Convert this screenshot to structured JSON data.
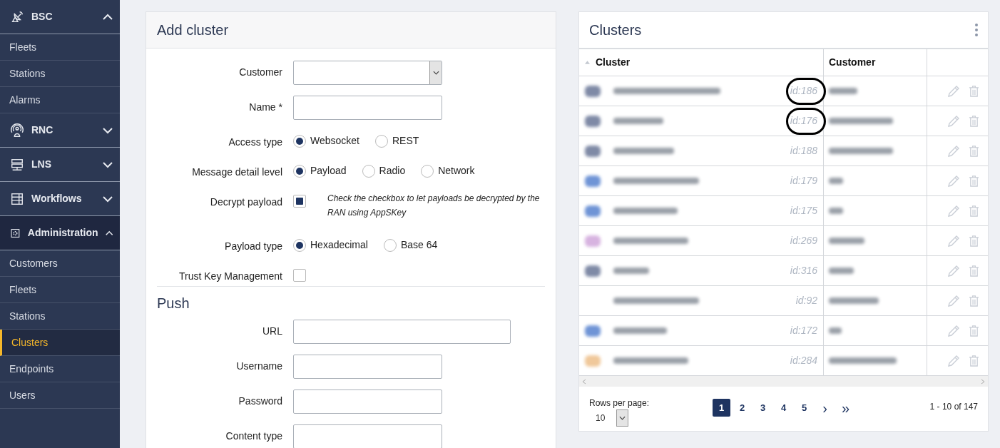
{
  "sidebar": {
    "sections": [
      {
        "label": "BSC",
        "expanded": true,
        "selected": false,
        "children": [
          {
            "label": "Fleets",
            "selected": false
          },
          {
            "label": "Stations",
            "selected": false
          },
          {
            "label": "Alarms",
            "selected": false
          }
        ]
      },
      {
        "label": "RNC",
        "expanded": false,
        "selected": false
      },
      {
        "label": "LNS",
        "expanded": false,
        "selected": false
      },
      {
        "label": "Workflows",
        "expanded": false,
        "selected": false
      },
      {
        "label": "Administration",
        "expanded": true,
        "selected": true,
        "children": [
          {
            "label": "Customers",
            "selected": false
          },
          {
            "label": "Fleets",
            "selected": false
          },
          {
            "label": "Stations",
            "selected": false
          },
          {
            "label": "Clusters",
            "selected": true
          },
          {
            "label": "Endpoints",
            "selected": false
          },
          {
            "label": "Users",
            "selected": false
          }
        ]
      }
    ]
  },
  "add_cluster": {
    "title": "Add cluster",
    "fields": [
      {
        "kind": "select",
        "label": "Customer"
      },
      {
        "kind": "text",
        "label": "Name *"
      },
      {
        "kind": "radio",
        "label": "Access type",
        "options": [
          {
            "label": "Websocket",
            "selected": true
          },
          {
            "label": "REST",
            "selected": false
          }
        ]
      },
      {
        "kind": "radio",
        "label": "Message detail level",
        "options": [
          {
            "label": "Payload",
            "selected": true
          },
          {
            "label": "Radio",
            "selected": false
          },
          {
            "label": "Network",
            "selected": false
          }
        ]
      },
      {
        "kind": "checkbox",
        "label": "Decrypt payload",
        "checked": true,
        "hint": "Check the checkbox to let payloads be decrypted by the RAN using AppSKey"
      },
      {
        "kind": "radio",
        "label": "Payload type",
        "options": [
          {
            "label": "Hexadecimal",
            "selected": true
          },
          {
            "label": "Base 64",
            "selected": false
          }
        ]
      },
      {
        "kind": "checkbox",
        "label": "Trust Key Management",
        "checked": false
      }
    ],
    "push": {
      "title": "Push",
      "fields": [
        {
          "kind": "wide",
          "label": "URL"
        },
        {
          "kind": "text",
          "label": "Username"
        },
        {
          "kind": "text",
          "label": "Password"
        },
        {
          "kind": "text",
          "label": "Content type"
        }
      ]
    }
  },
  "clusters": {
    "title": "Clusters",
    "columns": [
      "Cluster",
      "Customer"
    ],
    "rows": [
      {
        "id": "id:186",
        "color": "#7f8aa6",
        "circled": true
      },
      {
        "id": "id:176",
        "color": "#7f8aa6",
        "circled": true
      },
      {
        "id": "id:188",
        "color": "#7f8aa6",
        "circled": false
      },
      {
        "id": "id:179",
        "color": "#6f94d6",
        "circled": false
      },
      {
        "id": "id:175",
        "color": "#6f94d6",
        "circled": false
      },
      {
        "id": "id:269",
        "color": "#d7b3e0",
        "circled": false
      },
      {
        "id": "id:316",
        "color": "#7f8aa6",
        "circled": false
      },
      {
        "id": "id:92",
        "circled": false
      },
      {
        "id": "id:172",
        "color": "#6f94d6",
        "circled": false
      },
      {
        "id": "id:284",
        "color": "#f0c89a",
        "circled": false
      }
    ],
    "rows_per_page_label": "Rows per page:",
    "rows_per_page": "10",
    "pages": [
      {
        "label": "1",
        "selected": true
      },
      {
        "label": "2",
        "selected": false
      },
      {
        "label": "3",
        "selected": false
      },
      {
        "label": "4",
        "selected": false
      },
      {
        "label": "5",
        "selected": false
      }
    ],
    "next": "›",
    "last": "»",
    "range": "1 - 10 of 147"
  }
}
